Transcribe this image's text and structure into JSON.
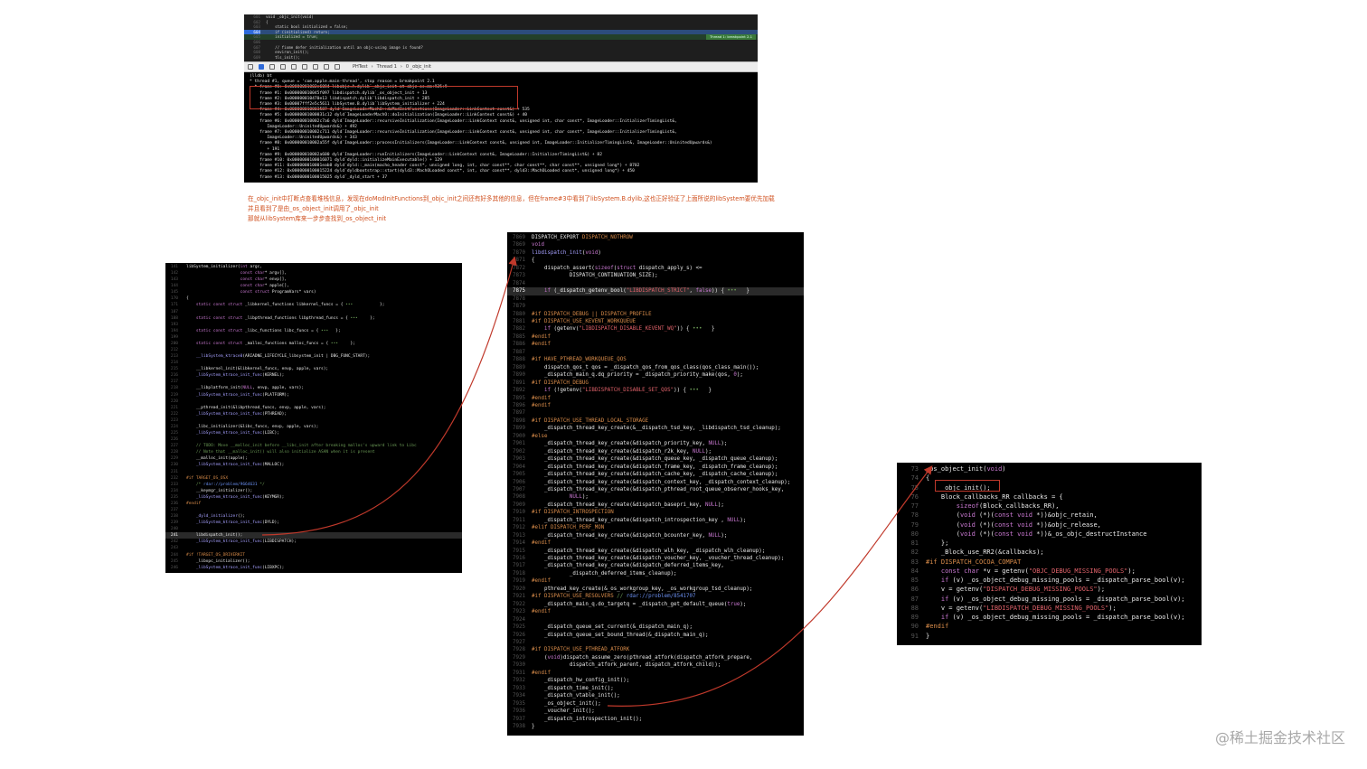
{
  "xcode_editor": {
    "lines": [
      {
        "num": "601",
        "text": "void _objc_init(void)"
      },
      {
        "num": "602",
        "text": "{"
      },
      {
        "num": "603",
        "text": "    static bool initialized = false;"
      },
      {
        "num": "604",
        "text": "    if (initialized) return;"
      },
      {
        "num": "605",
        "text": "    initialized = true;"
      },
      {
        "num": "606",
        "text": ""
      },
      {
        "num": "607",
        "text": "    // fixme defer initialization until an objc-using image is found?"
      },
      {
        "num": "608",
        "text": "    environ_init();"
      },
      {
        "num": "609",
        "text": "    tls_init();"
      }
    ],
    "breakpoint_tag": "Thread 1: breakpoint 2.1"
  },
  "debug_toolbar": {
    "target": "PHTest",
    "thread": "Thread 1",
    "frame": "0 _objc_init"
  },
  "console": {
    "lines": [
      "(lldb) bt",
      "* thread #1, queue = 'com.apple.main-thread', stop reason = breakpoint 2.1",
      "  * frame #0: 0x00000001002e6084 libobjc.A.dylib`_objc_init at objc-os.mm:925:9",
      "    frame #1: 0x000000010045f097 libdispatch.dylib`_os_object_init + 13",
      "    frame #2: 0x000000010470e13 libdispatch.dylib`libdispatch_init + 285",
      "    frame #3: 0x00007fff2e5c5611 libSystem.B.dylib`libSystem_initializer + 224",
      "    frame #4: 0x000000010003587 dyld`ImageLoaderMachO::doModInitFunctions(ImageLoader::LinkContext const&) + 535",
      "    frame #5: 0x00000001000031c12 dyld`ImageLoaderMachO::doInitialization(ImageLoader::LinkContext const&) + 40",
      "    frame #6: 0x000000010002c7a6 dyld`ImageLoader::recursiveInitialization(ImageLoader::LinkContext const&, unsigned int, char const*, ImageLoader::InitializerTimingList&,",
      "       ImageLoader::UninitedUpwards&) + 492",
      "    frame #7: 0x000000010002c711 dyld`ImageLoader::recursiveInitialization(ImageLoader::LinkContext const&, unsigned int, char const*, ImageLoader::InitializerTimingList&,",
      "       ImageLoader::UninitedUpwards&) + 343",
      "    frame #8: 0x000000010002a55f dyld`ImageLoader::processInitializers(ImageLoader::LinkContext const&, unsigned int, ImageLoader::InitializerTimingList&, ImageLoader::UninitedUpwards&)",
      "       + 191",
      "    frame #9: 0x000000010002a600 dyld`ImageLoader::runInitializers(ImageLoader::LinkContext const&, ImageLoader::InitializerTimingList&) + 82",
      "    frame #10: 0x0000000100016071 dyld`dyld::initializeMainExecutable() + 129",
      "    frame #11: 0x000000010001eab8 dyld`dyld::_main(macho_header const*, unsigned long, int, char const**, char const**, char const**, unsigned long*) + 8702",
      "    frame #12: 0x0000000100015224 dyld`dyldbootstrap::start(dyld3::MachOLoaded const*, int, char const**, dyld3::MachOLoaded const*, unsigned long*) + 450",
      "    frame #13: 0x0000000100015025 dyld`_dyld_start + 37"
    ]
  },
  "annotation": {
    "lines": [
      "在_objc_init中打断点查看堆栈信息，发现在doModInitFunctions到_objc_init之间还有好多其他的信息，但在frame#3中看到了libSystem.B.dylib,这也正好验证了上面所说的libSystem要优先加载",
      "并且看到了是由_os_object_init调用了_objc_init",
      "那就从libSystem库来一步步查找到_os_object_init"
    ]
  },
  "libsystem_panel": {
    "lines": [
      {
        "num": "141",
        "html": "libSystem_initializer(<span class='kw'>int</span> argc,"
      },
      {
        "num": "142",
        "html": "                      <span class='kw'>const char</span>* argv[],"
      },
      {
        "num": "143",
        "html": "                      <span class='kw'>const char</span>* envp[],"
      },
      {
        "num": "144",
        "html": "                      <span class='kw'>const char</span>* apple[],"
      },
      {
        "num": "145",
        "html": "                      <span class='kw'>const struct</span> ProgramVars* vars)"
      },
      {
        "num": "170",
        "html": "{"
      },
      {
        "num": "171",
        "html": "    <span class='kw'>static const struct</span> _libkernel_functions libkernel_funcs = {<span class='cmt'> ••• </span>          };"
      },
      {
        "num": "187",
        "html": ""
      },
      {
        "num": "188",
        "html": "    <span class='kw'>static const struct</span> _libpthread_functions libpthread_funcs = {<span class='cmt'> ••• </span>    };"
      },
      {
        "num": "193",
        "html": ""
      },
      {
        "num": "194",
        "html": "    <span class='kw'>static const struct</span> _libc_functions libc_funcs = {<span class='cmt'> ••• </span>  };"
      },
      {
        "num": "199",
        "html": ""
      },
      {
        "num": "200",
        "html": "    <span class='kw'>static const struct</span> _malloc_functions malloc_funcs = {<span class='cmt'> ••• </span>    };"
      },
      {
        "num": "212",
        "html": ""
      },
      {
        "num": "213",
        "html": "    <span class='fn'>__libSystem_ktrace0</span>(ARIADNE_LIFECYCLE_libsystem_init | DBG_FUNC_START);"
      },
      {
        "num": "214",
        "html": ""
      },
      {
        "num": "215",
        "html": "    __libkernel_init(&amp;libkernel_funcs, envp, apple, vars);"
      },
      {
        "num": "216",
        "html": "    <span class='fn'>_libSystem_ktrace_init_func</span>(KERNEL);"
      },
      {
        "num": "217",
        "html": ""
      },
      {
        "num": "218",
        "html": "    __libplatform_init(<span class='kw'>NULL</span>, envp, apple, vars);"
      },
      {
        "num": "219",
        "html": "    <span class='fn'>_libSystem_ktrace_init_func</span>(PLATFORM);"
      },
      {
        "num": "220",
        "html": ""
      },
      {
        "num": "221",
        "html": "    __pthread_init(&amp;libpthread_funcs, envp, apple, vars);"
      },
      {
        "num": "222",
        "html": "    <span class='fn'>_libSystem_ktrace_init_func</span>(PTHREAD);"
      },
      {
        "num": "223",
        "html": ""
      },
      {
        "num": "224",
        "html": "    _libc_initializer(&amp;libc_funcs, envp, apple, vars);"
      },
      {
        "num": "225",
        "html": "    <span class='fn'>_libSystem_ktrace_init_func</span>(LIBC);"
      },
      {
        "num": "226",
        "html": ""
      },
      {
        "num": "227",
        "html": "    <span class='cmt'>// TODO: Move __malloc_init before __libc_init after breaking malloc's upward link to Libc</span>"
      },
      {
        "num": "228",
        "html": "    <span class='cmt'>// Note that __malloc_init() will also initialize ASAN when it is present</span>"
      },
      {
        "num": "229",
        "html": "    __malloc_init(apple);"
      },
      {
        "num": "230",
        "html": "    <span class='fn'>_libSystem_ktrace_init_func</span>(MALLOC);"
      },
      {
        "num": "231",
        "html": ""
      },
      {
        "num": "232",
        "html": "<span class='pp'>#if TARGET_OS_OSX</span>"
      },
      {
        "num": "233",
        "html": "    <span class='cmt'>/* </span><span class='lnk'>rdar://problem/9664631</span><span class='cmt'> */</span>"
      },
      {
        "num": "234",
        "html": "    __keymgr_initializer();"
      },
      {
        "num": "235",
        "html": "    <span class='fn'>_libSystem_ktrace_init_func</span>(KEYMGR);"
      },
      {
        "num": "236",
        "html": "<span class='pp'>#endif</span>"
      },
      {
        "num": "237",
        "html": ""
      },
      {
        "num": "238",
        "html": "    <span class='fn'>_dyld_initializer</span>();"
      },
      {
        "num": "239",
        "html": "    <span class='fn'>_libSystem_ktrace_init_func</span>(DYLD);"
      },
      {
        "num": "240",
        "html": ""
      },
      {
        "num": "241",
        "html": "    libdispatch_init();",
        "hl": true
      },
      {
        "num": "242",
        "html": "    <span class='fn'>_libSystem_ktrace_init_func</span>(LIBDISPATCH);"
      },
      {
        "num": "243",
        "html": ""
      },
      {
        "num": "244",
        "html": "<span class='pp'>#if !TARGET_OS_DRIVERKIT</span>"
      },
      {
        "num": "245",
        "html": "    _libxpc_initializer();"
      },
      {
        "num": "246",
        "html": "    <span class='fn'>_libSystem_ktrace_init_func</span>(LIBXPC);"
      }
    ]
  },
  "libdispatch_panel": {
    "lines": [
      {
        "num": "7869",
        "html": "DISPATCH_EXPORT <span class='pp'>DISPATCH_NOTHROW</span>"
      },
      {
        "num": "7869",
        "html": "<span class='kw'>void</span>"
      },
      {
        "num": "7870",
        "html": "<span class='fn'>libdispatch_init</span>(<span class='kw'>void</span>)"
      },
      {
        "num": "7871",
        "html": "{"
      },
      {
        "num": "7872",
        "html": "    dispatch_assert(<span class='kw'>sizeof</span>(<span class='kw'>struct</span> dispatch_apply_s) &lt;="
      },
      {
        "num": "7873",
        "html": "            DISPATCH_CONTINUATION_SIZE);"
      },
      {
        "num": "7874",
        "html": ""
      },
      {
        "num": "7875",
        "html": "    <span class='kw'>if</span> (_dispatch_getenv_bool(<span class='str'>\"LIBDISPATCH_STRICT\"</span>, <span class='kw'>false</span>)) {<span class='cmt'> ••• </span>  }",
        "hl": true
      },
      {
        "num": "7878",
        "html": ""
      },
      {
        "num": "7879",
        "html": ""
      },
      {
        "num": "7880",
        "html": "<span class='pp'>#if DISPATCH_DEBUG || DISPATCH_PROFILE</span>"
      },
      {
        "num": "7881",
        "html": "<span class='pp'>#if DISPATCH_USE_KEVENT_WORKQUEUE</span>"
      },
      {
        "num": "7882",
        "html": "    <span class='kw'>if</span> (getenv(<span class='str'>\"LIBDISPATCH_DISABLE_KEVENT_WQ\"</span>)) {<span class='cmt'> ••• </span>  }"
      },
      {
        "num": "7885",
        "html": "<span class='pp'>#endif</span>"
      },
      {
        "num": "7886",
        "html": "<span class='pp'>#endif</span>"
      },
      {
        "num": "7887",
        "html": ""
      },
      {
        "num": "7888",
        "html": "<span class='pp'>#if HAVE_PTHREAD_WORKQUEUE_QOS</span>"
      },
      {
        "num": "7889",
        "html": "    dispatch_qos_t qos = _dispatch_qos_from_qos_class(qos_class_main());"
      },
      {
        "num": "7890",
        "html": "    _dispatch_main_q.dq_priority = _dispatch_priority_make(qos, <span class='kw'>0</span>);"
      },
      {
        "num": "7891",
        "html": "<span class='pp'>#if DISPATCH_DEBUG</span>"
      },
      {
        "num": "7892",
        "html": "    <span class='kw'>if</span> (!getenv(<span class='str'>\"LIBDISPATCH_DISABLE_SET_QOS\"</span>)) {<span class='cmt'> ••• </span>  }"
      },
      {
        "num": "7895",
        "html": "<span class='pp'>#endif</span>"
      },
      {
        "num": "7896",
        "html": "<span class='pp'>#endif</span>"
      },
      {
        "num": "7897",
        "html": ""
      },
      {
        "num": "7898",
        "html": "<span class='pp'>#if DISPATCH_USE_THREAD_LOCAL_STORAGE</span>"
      },
      {
        "num": "7899",
        "html": "    _dispatch_thread_key_create(&amp;__dispatch_tsd_key, _libdispatch_tsd_cleanup);"
      },
      {
        "num": "7900",
        "html": "<span class='pp'>#else</span>"
      },
      {
        "num": "7901",
        "html": "    _dispatch_thread_key_create(&amp;dispatch_priority_key, <span class='kw'>NULL</span>);"
      },
      {
        "num": "7902",
        "html": "    _dispatch_thread_key_create(&amp;dispatch_r2k_key, <span class='kw'>NULL</span>);"
      },
      {
        "num": "7903",
        "html": "    _dispatch_thread_key_create(&amp;dispatch_queue_key, _dispatch_queue_cleanup);"
      },
      {
        "num": "7904",
        "html": "    _dispatch_thread_key_create(&amp;dispatch_frame_key, _dispatch_frame_cleanup);"
      },
      {
        "num": "7905",
        "html": "    _dispatch_thread_key_create(&amp;dispatch_cache_key, _dispatch_cache_cleanup);"
      },
      {
        "num": "7906",
        "html": "    _dispatch_thread_key_create(&amp;dispatch_context_key, _dispatch_context_cleanup);"
      },
      {
        "num": "7907",
        "html": "    _dispatch_thread_key_create(&amp;dispatch_pthread_root_queue_observer_hooks_key,"
      },
      {
        "num": "7908",
        "html": "            <span class='kw'>NULL</span>);"
      },
      {
        "num": "7909",
        "html": "    _dispatch_thread_key_create(&amp;dispatch_basepri_key, <span class='kw'>NULL</span>);"
      },
      {
        "num": "7910",
        "html": "<span class='pp'>#if DISPATCH_INTROSPECTION</span>"
      },
      {
        "num": "7911",
        "html": "    _dispatch_thread_key_create(&amp;dispatch_introspection_key , <span class='kw'>NULL</span>);"
      },
      {
        "num": "7912",
        "html": "<span class='pp'>#elif DISPATCH_PERF_MON</span>"
      },
      {
        "num": "7913",
        "html": "    _dispatch_thread_key_create(&amp;dispatch_bcounter_key, <span class='kw'>NULL</span>);"
      },
      {
        "num": "7914",
        "html": "<span class='pp'>#endif</span>"
      },
      {
        "num": "7915",
        "html": "    _dispatch_thread_key_create(&amp;dispatch_wlh_key, _dispatch_wlh_cleanup);"
      },
      {
        "num": "7916",
        "html": "    _dispatch_thread_key_create(&amp;dispatch_voucher_key, _voucher_thread_cleanup);"
      },
      {
        "num": "7917",
        "html": "    _dispatch_thread_key_create(&amp;dispatch_deferred_items_key,"
      },
      {
        "num": "7918",
        "html": "            _dispatch_deferred_items_cleanup);"
      },
      {
        "num": "7919",
        "html": "<span class='pp'>#endif</span>"
      },
      {
        "num": "7920",
        "html": "    pthread_key_create(&amp;_os_workgroup_key, _os_workgroup_tsd_cleanup);"
      },
      {
        "num": "7921",
        "html": "<span class='pp'>#if DISPATCH_USE_RESOLVERS</span> <span class='cmt'>// </span><span class='lnk'>rdar://problem/8541707</span>"
      },
      {
        "num": "7922",
        "html": "    _dispatch_main_q.do_targetq = _dispatch_get_default_queue(<span class='kw'>true</span>);"
      },
      {
        "num": "7923",
        "html": "<span class='pp'>#endif</span>"
      },
      {
        "num": "7924",
        "html": ""
      },
      {
        "num": "7925",
        "html": "    _dispatch_queue_set_current(&amp;_dispatch_main_q);"
      },
      {
        "num": "7926",
        "html": "    _dispatch_queue_set_bound_thread(&amp;_dispatch_main_q);"
      },
      {
        "num": "7927",
        "html": ""
      },
      {
        "num": "7928",
        "html": "<span class='pp'>#if DISPATCH_USE_PTHREAD_ATFORK</span>"
      },
      {
        "num": "7929",
        "html": "    (<span class='kw'>void</span>)dispatch_assume_zero(pthread_atfork(dispatch_atfork_prepare,"
      },
      {
        "num": "7930",
        "html": "            dispatch_atfork_parent, dispatch_atfork_child));"
      },
      {
        "num": "7931",
        "html": "<span class='pp'>#endif</span>"
      },
      {
        "num": "7932",
        "html": "    _dispatch_hw_config_init();"
      },
      {
        "num": "7933",
        "html": "    _dispatch_time_init();"
      },
      {
        "num": "7934",
        "html": "    _dispatch_vtable_init();"
      },
      {
        "num": "7935",
        "html": "    _os_object_init();"
      },
      {
        "num": "7936",
        "html": "    _voucher_init();"
      },
      {
        "num": "7937",
        "html": "    _dispatch_introspection_init();"
      },
      {
        "num": "7938",
        "html": "}"
      }
    ]
  },
  "os_object_panel": {
    "lines": [
      {
        "num": "73",
        "html": "_os_object_init(<span class='kw'>void</span>)"
      },
      {
        "num": "74",
        "html": "{"
      },
      {
        "num": "75",
        "html": "    _objc_init();"
      },
      {
        "num": "76",
        "html": "    Block_callbacks_RR callbacks = {"
      },
      {
        "num": "77",
        "html": "        <span class='kw'>sizeof</span>(Block_callbacks_RR),"
      },
      {
        "num": "78",
        "html": "        (<span class='kw'>void</span> (*)(<span class='kw'>const void</span> *))&amp;objc_retain,"
      },
      {
        "num": "79",
        "html": "        (<span class='kw'>void</span> (*)(<span class='kw'>const void</span> *))&amp;objc_release,"
      },
      {
        "num": "80",
        "html": "        (<span class='kw'>void</span> (*)(<span class='kw'>const void</span> *))&amp;_os_objc_destructInstance"
      },
      {
        "num": "81",
        "html": "    };"
      },
      {
        "num": "82",
        "html": "    _Block_use_RR2(&amp;callbacks);"
      },
      {
        "num": "83",
        "html": "<span class='pp'>#if DISPATCH_COCOA_COMPAT</span>"
      },
      {
        "num": "84",
        "html": "    <span class='kw'>const char</span> *v = getenv(<span class='str'>\"OBJC_DEBUG_MISSING_POOLS\"</span>);"
      },
      {
        "num": "85",
        "html": "    <span class='kw'>if</span> (v) _os_object_debug_missing_pools = _dispatch_parse_bool(v);"
      },
      {
        "num": "86",
        "html": "    v = getenv(<span class='str'>\"DISPATCH_DEBUG_MISSING_POOLS\"</span>);"
      },
      {
        "num": "87",
        "html": "    <span class='kw'>if</span> (v) _os_object_debug_missing_pools = _dispatch_parse_bool(v);"
      },
      {
        "num": "88",
        "html": "    v = getenv(<span class='str'>\"LIBDISPATCH_DEBUG_MISSING_POOLS\"</span>);"
      },
      {
        "num": "89",
        "html": "    <span class='kw'>if</span> (v) _os_object_debug_missing_pools = _dispatch_parse_bool(v);"
      },
      {
        "num": "90",
        "html": "<span class='pp'>#endif</span>"
      },
      {
        "num": "91",
        "html": "}"
      }
    ]
  },
  "watermark": "@稀土掘金技术社区",
  "colors": {
    "arrow": "#c0392b",
    "annotation_text": "#d0501f"
  }
}
